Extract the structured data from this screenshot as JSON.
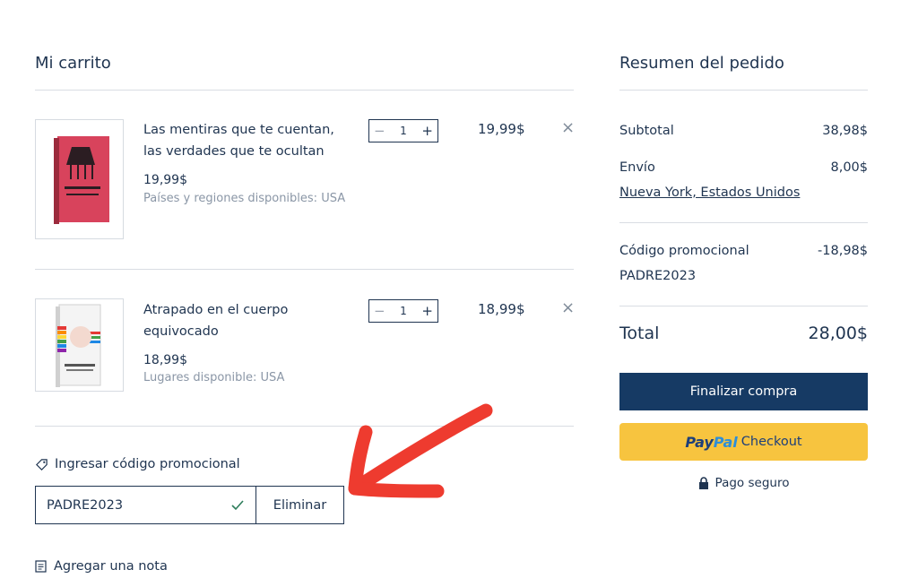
{
  "cart": {
    "title": "Mi carrito",
    "items": [
      {
        "name": "Las mentiras que te cuentan, las verdades que te ocultan",
        "price": "19,99$",
        "availability": "Países y regiones disponibles: USA",
        "quantity": "1",
        "line_total": "19,99$",
        "cover_color": "#d8435c"
      },
      {
        "name": "Atrapado en el cuerpo equivocado",
        "price": "18,99$",
        "availability": "Lugares disponible: USA",
        "quantity": "1",
        "line_total": "18,99$",
        "cover_color": "#f2f2f2"
      }
    ],
    "qty_minus": "−",
    "qty_plus": "+",
    "remove_symbol": "×",
    "promo": {
      "label": "Ingresar código promocional",
      "value": "PADRE2023",
      "remove_label": "Eliminar"
    },
    "note": {
      "label": "Agregar una nota"
    }
  },
  "summary": {
    "title": "Resumen del pedido",
    "subtotal_label": "Subtotal",
    "subtotal_value": "38,98$",
    "shipping_label": "Envío",
    "shipping_value": "8,00$",
    "shipping_location": "Nueva York, Estados Unidos",
    "promo_label": "Código promocional",
    "promo_value": "-18,98$",
    "promo_code": "PADRE2023",
    "total_label": "Total",
    "total_value": "28,00$",
    "checkout_label": "Finalizar compra",
    "paypal_brand_1": "Pay",
    "paypal_brand_2": "Pal",
    "paypal_checkout": "Checkout",
    "secure_label": "Pago seguro"
  },
  "annotation": {
    "arrow_color": "#ee3b2f"
  },
  "colors": {
    "primary": "#163a64",
    "paypal": "#f7c43f",
    "text": "#1f3450"
  }
}
